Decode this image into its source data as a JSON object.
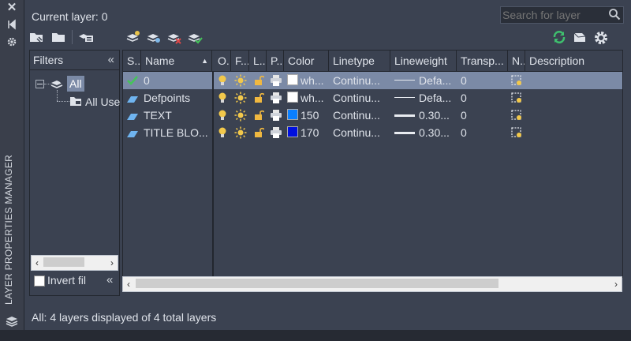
{
  "palette_title": "LAYER PROPERTIES MANAGER",
  "current_layer": "Current layer: 0",
  "search": {
    "placeholder": "Search for layer"
  },
  "filters": {
    "header": "Filters",
    "tree": [
      {
        "label": "All",
        "selected": true
      },
      {
        "label": "All Use"
      }
    ],
    "invert_label": "Invert fil"
  },
  "columns": [
    "S...",
    "Name",
    "O...",
    "F...",
    "L...",
    "P...",
    "Color",
    "Linetype",
    "Lineweight",
    "Transp...",
    "N...",
    "Description"
  ],
  "layers": [
    {
      "name": "0",
      "current": true,
      "selected": true,
      "color": "wh...",
      "swatch": "#ffffff",
      "linetype": "Continu...",
      "lineweight": "Defa...",
      "lwstyle": "thin",
      "transparency": "0"
    },
    {
      "name": "Defpoints",
      "current": false,
      "selected": false,
      "color": "wh...",
      "swatch": "#ffffff",
      "linetype": "Continu...",
      "lineweight": "Defa...",
      "lwstyle": "thin",
      "transparency": "0"
    },
    {
      "name": "TEXT",
      "current": false,
      "selected": false,
      "color": "150",
      "swatch": "#0a7fff",
      "linetype": "Continu...",
      "lineweight": "0.30...",
      "lwstyle": "thick",
      "transparency": "0"
    },
    {
      "name": "TITLE BLO...",
      "current": false,
      "selected": false,
      "color": "170",
      "swatch": "#0010e0",
      "linetype": "Continu...",
      "lineweight": "0.30...",
      "lwstyle": "thick",
      "transparency": "0"
    }
  ],
  "status": "All: 4 layers displayed of 4 total layers",
  "icons": {
    "on": "lightbulb-icon",
    "freeze": "sun-icon",
    "lock": "unlock-icon",
    "plot": "printer-icon",
    "refresh": "refresh-icon",
    "settings": "gear-icon",
    "close": "close-icon"
  }
}
